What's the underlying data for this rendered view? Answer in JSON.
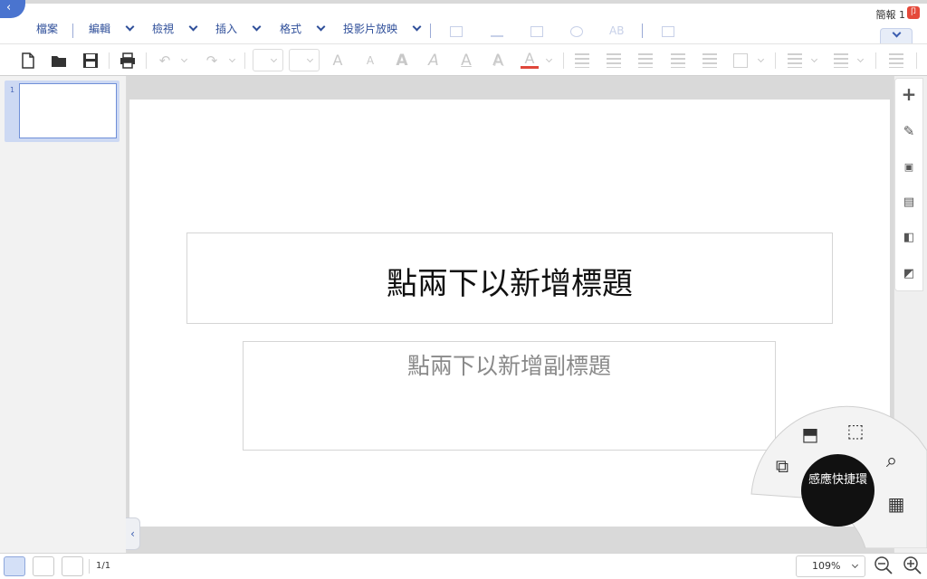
{
  "doc": {
    "title": "簡報 1",
    "badge": "卩"
  },
  "menu": [
    {
      "label": "檔案"
    },
    {
      "label": "編輯"
    },
    {
      "label": "檢視"
    },
    {
      "label": "插入"
    },
    {
      "label": "格式"
    },
    {
      "label": "投影片放映"
    }
  ],
  "menu_disabled_icons": [
    "table-icon",
    "chart-icon",
    "image-icon",
    "shapes-icon",
    "spellcheck-icon",
    "comment-icon"
  ],
  "toolbar": {
    "font_glyph": "A",
    "buttons": [
      "new-file",
      "open-folder",
      "save",
      "print",
      "undo",
      "redo",
      "font-name",
      "font-size",
      "grow-font",
      "shrink-font",
      "bold",
      "italic",
      "underline",
      "shadow",
      "font-color",
      "align-left",
      "align-center",
      "align-right",
      "justify",
      "distributed",
      "text-box-format",
      "bullets",
      "numbering",
      "indent"
    ],
    "font_color": "#e0473b"
  },
  "slides": [
    {
      "number": "1"
    }
  ],
  "slide": {
    "title_placeholder": "點兩下以新增標題",
    "subtitle_placeholder": "點兩下以新增副標題"
  },
  "right_tools": [
    "add-icon",
    "format-shape-icon",
    "text-format-icon",
    "layout-icon",
    "transition-icon",
    "notes-icon"
  ],
  "quick_ring": {
    "label": "感應快捷環",
    "tools": [
      "crop-icon",
      "screenshot-edit-icon",
      "zoom-search-icon",
      "region-edit-icon",
      "image-search-icon"
    ]
  },
  "status": {
    "page_count": "1/1",
    "zoom": "109%",
    "views": [
      "normal-view",
      "slide-sorter-view",
      "presentation-view"
    ]
  },
  "colors": {
    "accent": "#4a74cf",
    "menu_text": "#2f4f9a",
    "ring": "#111111"
  }
}
